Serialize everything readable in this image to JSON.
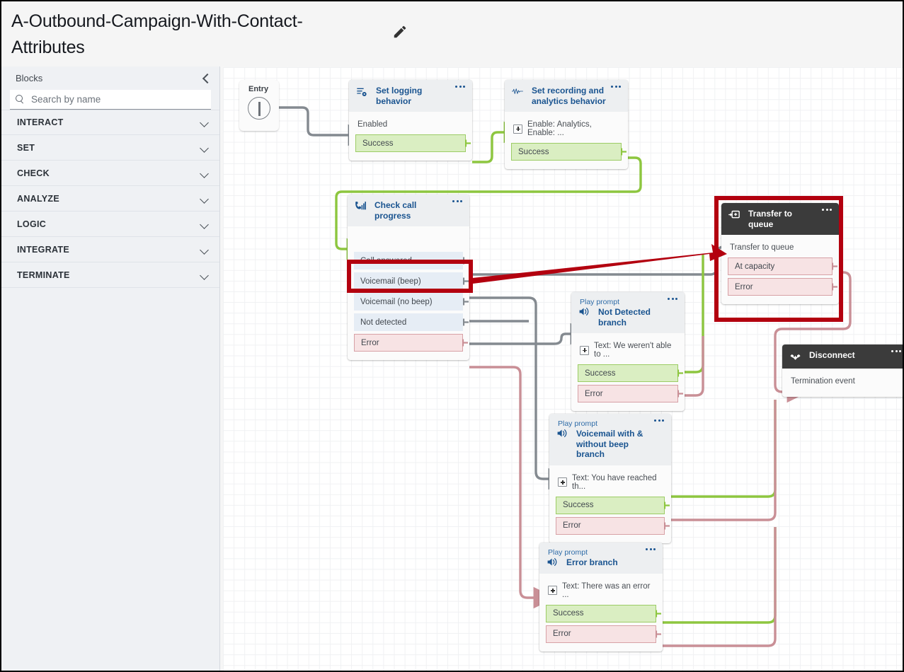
{
  "header": {
    "title": "A-Outbound-Campaign-With-Contact-Attributes",
    "edit_icon": "pencil-icon"
  },
  "sidebar": {
    "panel_label": "Blocks",
    "collapse_icon": "chevron-left-icon",
    "search": {
      "icon": "search-icon",
      "placeholder": "Search by name",
      "value": ""
    },
    "categories": [
      {
        "label": "INTERACT",
        "icon": "chevron-down-icon"
      },
      {
        "label": "SET",
        "icon": "chevron-down-icon"
      },
      {
        "label": "CHECK",
        "icon": "chevron-down-icon"
      },
      {
        "label": "ANALYZE",
        "icon": "chevron-down-icon"
      },
      {
        "label": "LOGIC",
        "icon": "chevron-down-icon"
      },
      {
        "label": "INTEGRATE",
        "icon": "chevron-down-icon"
      },
      {
        "label": "TERMINATE",
        "icon": "chevron-down-icon"
      }
    ]
  },
  "canvas": {
    "entry": {
      "label": "Entry",
      "icon": "entry-play-icon"
    },
    "nodes": [
      {
        "id": "set-logging",
        "kicker": "",
        "title": "Set logging behavior",
        "icon": "set-logging-icon",
        "menu_icon": "overflow-menu-icon",
        "entry_text": "Enabled",
        "branches": [
          {
            "label": "Success",
            "kind": "success"
          }
        ]
      },
      {
        "id": "set-recording",
        "kicker": "",
        "title": "Set recording and analytics behavior",
        "icon": "waveform-icon",
        "menu_icon": "overflow-menu-icon",
        "entry_text": "Enable: Analytics, Enable: ...",
        "entry_has_plus": true,
        "branches": [
          {
            "label": "Success",
            "kind": "success"
          }
        ]
      },
      {
        "id": "check-call-progress",
        "kicker": "",
        "title": "Check call progress",
        "icon": "call-progress-icon",
        "menu_icon": "overflow-menu-icon",
        "entry_text": "",
        "branches": [
          {
            "label": "Call answered",
            "kind": "blue"
          },
          {
            "label": "Voicemail (beep)",
            "kind": "blue"
          },
          {
            "label": "Voicemail (no beep)",
            "kind": "blue"
          },
          {
            "label": "Not detected",
            "kind": "blue"
          },
          {
            "label": "Error",
            "kind": "error"
          }
        ],
        "highlighted_branch": "Call answered"
      },
      {
        "id": "transfer-to-queue",
        "kicker": "",
        "title": "Transfer to queue",
        "icon": "transfer-queue-icon",
        "menu_icon": "overflow-menu-icon",
        "dark_header": true,
        "entry_text": "Transfer to queue",
        "branches": [
          {
            "label": "At capacity",
            "kind": "error"
          },
          {
            "label": "Error",
            "kind": "error"
          }
        ],
        "highlighted": true
      },
      {
        "id": "not-detected-branch",
        "kicker": "Play prompt",
        "title": "Not Detected branch",
        "icon": "speaker-icon",
        "menu_icon": "overflow-menu-icon",
        "entry_text": "Text: We weren't able to ...",
        "entry_has_plus": true,
        "branches": [
          {
            "label": "Success",
            "kind": "success"
          },
          {
            "label": "Error",
            "kind": "error"
          }
        ]
      },
      {
        "id": "voicemail-branch",
        "kicker": "Play prompt",
        "title": "Voicemail with & without beep branch",
        "icon": "speaker-icon",
        "menu_icon": "overflow-menu-icon",
        "entry_text": "Text: You have reached th...",
        "entry_has_plus": true,
        "branches": [
          {
            "label": "Success",
            "kind": "success"
          },
          {
            "label": "Error",
            "kind": "error"
          }
        ]
      },
      {
        "id": "error-branch",
        "kicker": "Play prompt",
        "title": "Error branch",
        "icon": "speaker-icon",
        "menu_icon": "overflow-menu-icon",
        "entry_text": "Text: There was an error ...",
        "entry_has_plus": true,
        "branches": [
          {
            "label": "Success",
            "kind": "success"
          },
          {
            "label": "Error",
            "kind": "error"
          }
        ]
      },
      {
        "id": "disconnect",
        "kicker": "",
        "title": "Disconnect",
        "icon": "disconnect-icon",
        "menu_icon": "overflow-menu-icon",
        "dark_header": true,
        "entry_text": "Termination event",
        "branches": []
      }
    ],
    "colors": {
      "success_wire": "#8dc63f",
      "error_wire": "#d9a2a8",
      "default_wire": "#848a90",
      "highlight_red": "#b3000f",
      "dark_header": "#3b3b3b",
      "accent_blue": "#1a5490"
    }
  }
}
